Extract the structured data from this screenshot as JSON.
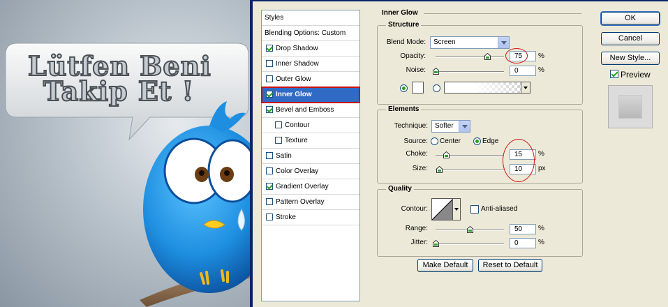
{
  "artwork": {
    "line1": "Lütfen Beni",
    "line2": "Takip Et !"
  },
  "styles_panel": {
    "items": [
      {
        "label": "Styles",
        "checkbox": false,
        "checked": false,
        "indent": 0,
        "selected": false
      },
      {
        "label": "Blending Options: Custom",
        "checkbox": false,
        "checked": false,
        "indent": 0,
        "selected": false
      },
      {
        "label": "Drop Shadow",
        "checkbox": true,
        "checked": true,
        "indent": 0,
        "selected": false
      },
      {
        "label": "Inner Shadow",
        "checkbox": true,
        "checked": false,
        "indent": 0,
        "selected": false
      },
      {
        "label": "Outer Glow",
        "checkbox": true,
        "checked": false,
        "indent": 0,
        "selected": false
      },
      {
        "label": "Inner Glow",
        "checkbox": true,
        "checked": true,
        "indent": 0,
        "selected": true
      },
      {
        "label": "Bevel and Emboss",
        "checkbox": true,
        "checked": true,
        "indent": 0,
        "selected": false
      },
      {
        "label": "Contour",
        "checkbox": true,
        "checked": false,
        "indent": 1,
        "selected": false
      },
      {
        "label": "Texture",
        "checkbox": true,
        "checked": false,
        "indent": 1,
        "selected": false
      },
      {
        "label": "Satin",
        "checkbox": true,
        "checked": false,
        "indent": 0,
        "selected": false
      },
      {
        "label": "Color Overlay",
        "checkbox": true,
        "checked": false,
        "indent": 0,
        "selected": false
      },
      {
        "label": "Gradient Overlay",
        "checkbox": true,
        "checked": true,
        "indent": 0,
        "selected": false
      },
      {
        "label": "Pattern Overlay",
        "checkbox": true,
        "checked": false,
        "indent": 0,
        "selected": false
      },
      {
        "label": "Stroke",
        "checkbox": true,
        "checked": false,
        "indent": 0,
        "selected": false
      }
    ]
  },
  "inner_glow": {
    "title": "Inner Glow",
    "structure": {
      "title": "Structure",
      "blend_mode_label": "Blend Mode:",
      "blend_mode_value": "Screen",
      "opacity_label": "Opacity:",
      "opacity_value": "75",
      "opacity_slider": 0.75,
      "noise_label": "Noise:",
      "noise_value": "0",
      "noise_slider": 0,
      "unit_percent": "%"
    },
    "elements": {
      "title": "Elements",
      "technique_label": "Technique:",
      "technique_value": "Softer",
      "source_label": "Source:",
      "source_center": "Center",
      "source_edge": "Edge",
      "source_selected": "Edge",
      "choke_label": "Choke:",
      "choke_value": "15",
      "choke_slider": 0.15,
      "size_label": "Size:",
      "size_value": "10",
      "size_slider": 0.05,
      "unit_percent": "%",
      "unit_px": "px"
    },
    "quality": {
      "title": "Quality",
      "contour_label": "Contour:",
      "anti_aliased_label": "Anti-aliased",
      "anti_aliased_checked": false,
      "range_label": "Range:",
      "range_value": "50",
      "range_slider": 0.5,
      "jitter_label": "Jitter:",
      "jitter_value": "0",
      "jitter_slider": 0,
      "unit_percent": "%"
    },
    "make_default": "Make Default",
    "reset_default": "Reset to Default"
  },
  "buttons": {
    "ok": "OK",
    "cancel": "Cancel",
    "new_style": "New Style...",
    "preview": "Preview",
    "preview_checked": true
  },
  "colors": {
    "selection": "#316ac5",
    "highlight_red": "#d01010",
    "bird_blue": "#1e8fe0"
  }
}
